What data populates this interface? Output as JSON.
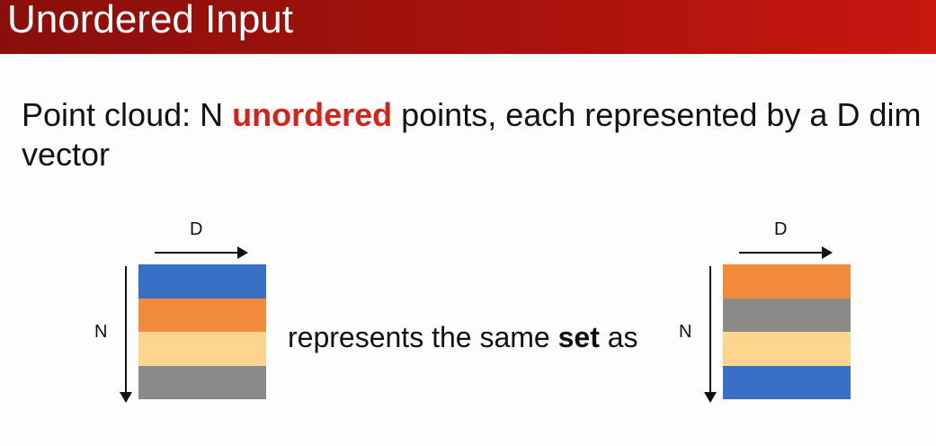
{
  "title": "Unordered Input",
  "body": {
    "part1": "Point cloud: N ",
    "emph": "unordered",
    "part2": " points, each represented by a D dim vector"
  },
  "left_matrix": {
    "d_label": "D",
    "n_label": "N",
    "rows": [
      {
        "name": "blue",
        "color": "#3a6fc6"
      },
      {
        "name": "orange",
        "color": "#f28b3c"
      },
      {
        "name": "light-yellow",
        "color": "#fdd58f"
      },
      {
        "name": "gray",
        "color": "#8a8a8a"
      }
    ]
  },
  "middle": {
    "pre": "represents the same ",
    "bold": "set",
    "post": " as"
  },
  "right_matrix": {
    "d_label": "D",
    "n_label": "N",
    "rows": [
      {
        "name": "orange",
        "color": "#f28b3c"
      },
      {
        "name": "gray",
        "color": "#8a8a8a"
      },
      {
        "name": "light-yellow",
        "color": "#fdd58f"
      },
      {
        "name": "blue",
        "color": "#3a6fc6"
      }
    ]
  },
  "colors": {
    "title_bar": "#a8120d",
    "emphasis": "#d22417"
  }
}
